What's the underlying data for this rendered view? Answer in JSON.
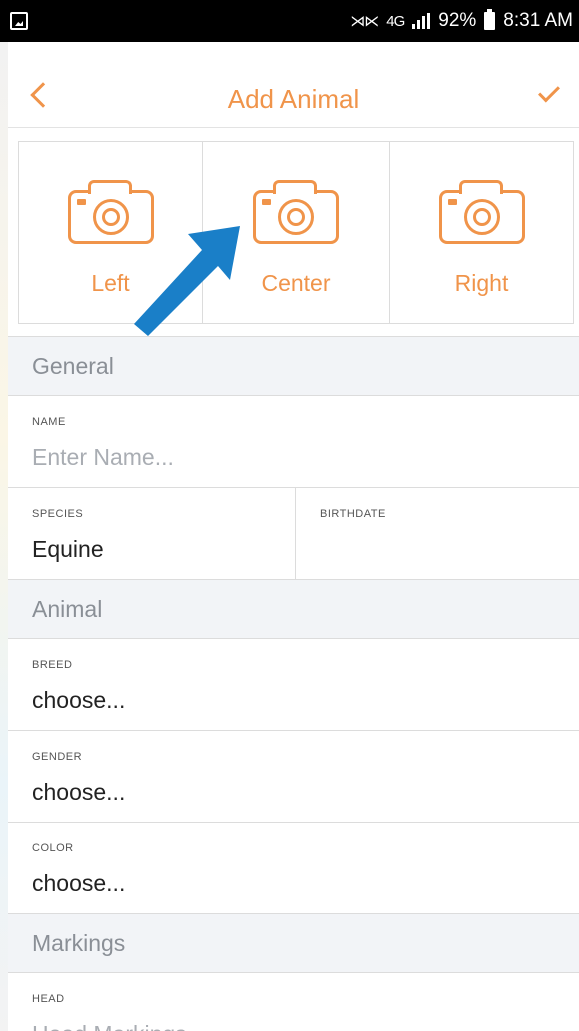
{
  "status_bar": {
    "network": "4G",
    "battery": "92%",
    "time": "8:31 AM"
  },
  "nav": {
    "title": "Add Animal"
  },
  "photos": [
    {
      "label": "Left"
    },
    {
      "label": "Center"
    },
    {
      "label": "Right"
    }
  ],
  "sections": {
    "general": "General",
    "animal": "Animal",
    "markings": "Markings"
  },
  "fields": {
    "name": {
      "label": "NAME",
      "placeholder": "Enter Name..."
    },
    "species": {
      "label": "SPECIES",
      "value": "Equine"
    },
    "birthdate": {
      "label": "BIRTHDATE",
      "value": ""
    },
    "breed": {
      "label": "BREED",
      "value": "choose..."
    },
    "gender": {
      "label": "GENDER",
      "value": "choose..."
    },
    "color": {
      "label": "COLOR",
      "value": "choose..."
    },
    "head": {
      "label": "HEAD",
      "placeholder": "Head Markings"
    }
  },
  "colors": {
    "accent": "#f0944a",
    "annotation_arrow": "#1a7fc8",
    "section_bg": "#f2f4f7"
  },
  "icons": [
    "gallery-icon",
    "mute-icon",
    "signal-icon",
    "battery-icon",
    "back-chevron-icon",
    "checkmark-icon",
    "camera-icon"
  ]
}
